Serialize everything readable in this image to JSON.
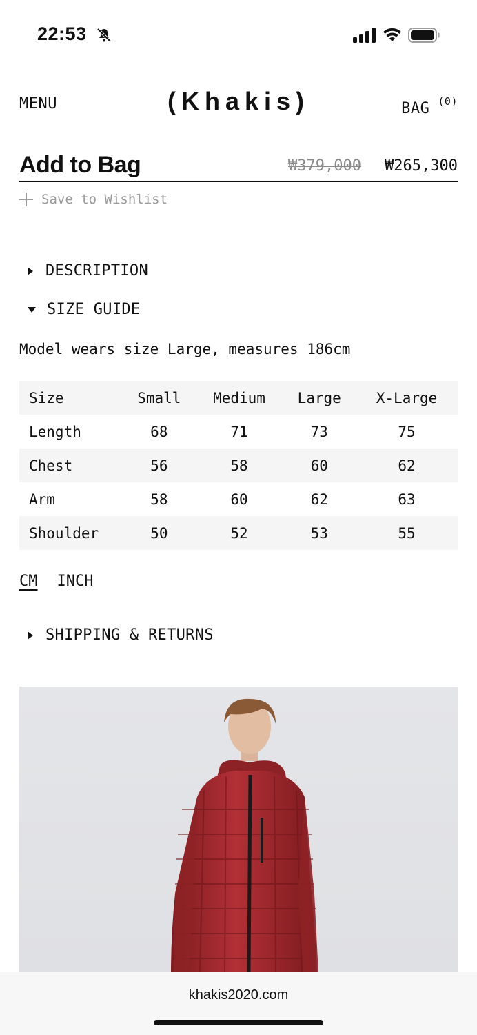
{
  "status": {
    "time": "22:53",
    "icons": [
      "bell-slash-icon",
      "signal-icon",
      "wifi-icon",
      "battery-icon"
    ]
  },
  "header": {
    "menu_label": "MENU",
    "logo": "(Khakis)",
    "bag_label": "BAG",
    "bag_count": "(0)"
  },
  "purchase": {
    "add_to_bag": "Add to Bag",
    "price_original": "₩379,000",
    "price_sale": "₩265,300",
    "wishlist": "Save to Wishlist"
  },
  "sections": {
    "description": "DESCRIPTION",
    "size_guide": "SIZE GUIDE",
    "shipping": "SHIPPING & RETURNS"
  },
  "size_guide": {
    "model_note": "Model wears size Large, measures 186cm",
    "headers": [
      "Size",
      "Small",
      "Medium",
      "Large",
      "X-Large"
    ],
    "rows": [
      [
        "Length",
        "68",
        "71",
        "73",
        "75"
      ],
      [
        "Chest",
        "56",
        "58",
        "60",
        "62"
      ],
      [
        "Arm",
        "58",
        "60",
        "62",
        "63"
      ],
      [
        "Shoulder",
        "50",
        "52",
        "53",
        "55"
      ]
    ],
    "units": [
      "CM",
      "INCH"
    ],
    "selected_unit": "CM"
  },
  "browser": {
    "url": "khakis2020.com"
  },
  "colors": {
    "text": "#111111",
    "muted": "#8a8a8a",
    "table_shade": "#f5f5f5",
    "jacket": "#a2282c"
  }
}
